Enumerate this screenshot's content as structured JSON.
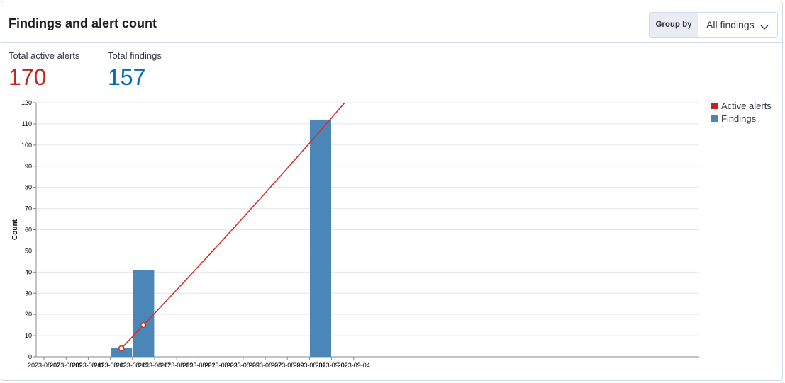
{
  "header": {
    "title": "Findings and alert count",
    "group_by_label": "Group by",
    "group_by_value": "All findings"
  },
  "stats": {
    "alerts_label": "Total active alerts",
    "alerts_value": "170",
    "findings_label": "Total findings",
    "findings_value": "157"
  },
  "colors": {
    "alerts": "#bd271e",
    "findings": "#4a86b8",
    "alerts_line": "#d0342c"
  },
  "chart_data": {
    "type": "bar",
    "ylabel": "Count",
    "ylim": [
      0,
      120
    ],
    "yticks": [
      0,
      10,
      20,
      30,
      40,
      50,
      60,
      70,
      80,
      90,
      100,
      110,
      120
    ],
    "x_tick_labels": [
      "2023-08-07",
      "2023-08-09",
      "2023-08-11",
      "2023-08-13",
      "2023-08-15",
      "2023-08-17",
      "2023-08-19",
      "2023-08-21",
      "2023-08-23",
      "2023-08-25",
      "2023-08-27",
      "2023-08-29",
      "2023-08-31",
      "2023-09-02",
      "2023-09-04"
    ],
    "grid": true,
    "legend_position": "right",
    "series": [
      {
        "name": "Findings",
        "kind": "bar",
        "points": [
          {
            "x": "2023-08-14",
            "y": 4
          },
          {
            "x": "2023-08-16",
            "y": 41
          },
          {
            "x": "2023-09-01",
            "y": 112
          }
        ]
      },
      {
        "name": "Active alerts",
        "kind": "line",
        "points": [
          {
            "x": "2023-08-14",
            "y": 4
          },
          {
            "x": "2023-08-16",
            "y": 15
          }
        ]
      }
    ]
  }
}
